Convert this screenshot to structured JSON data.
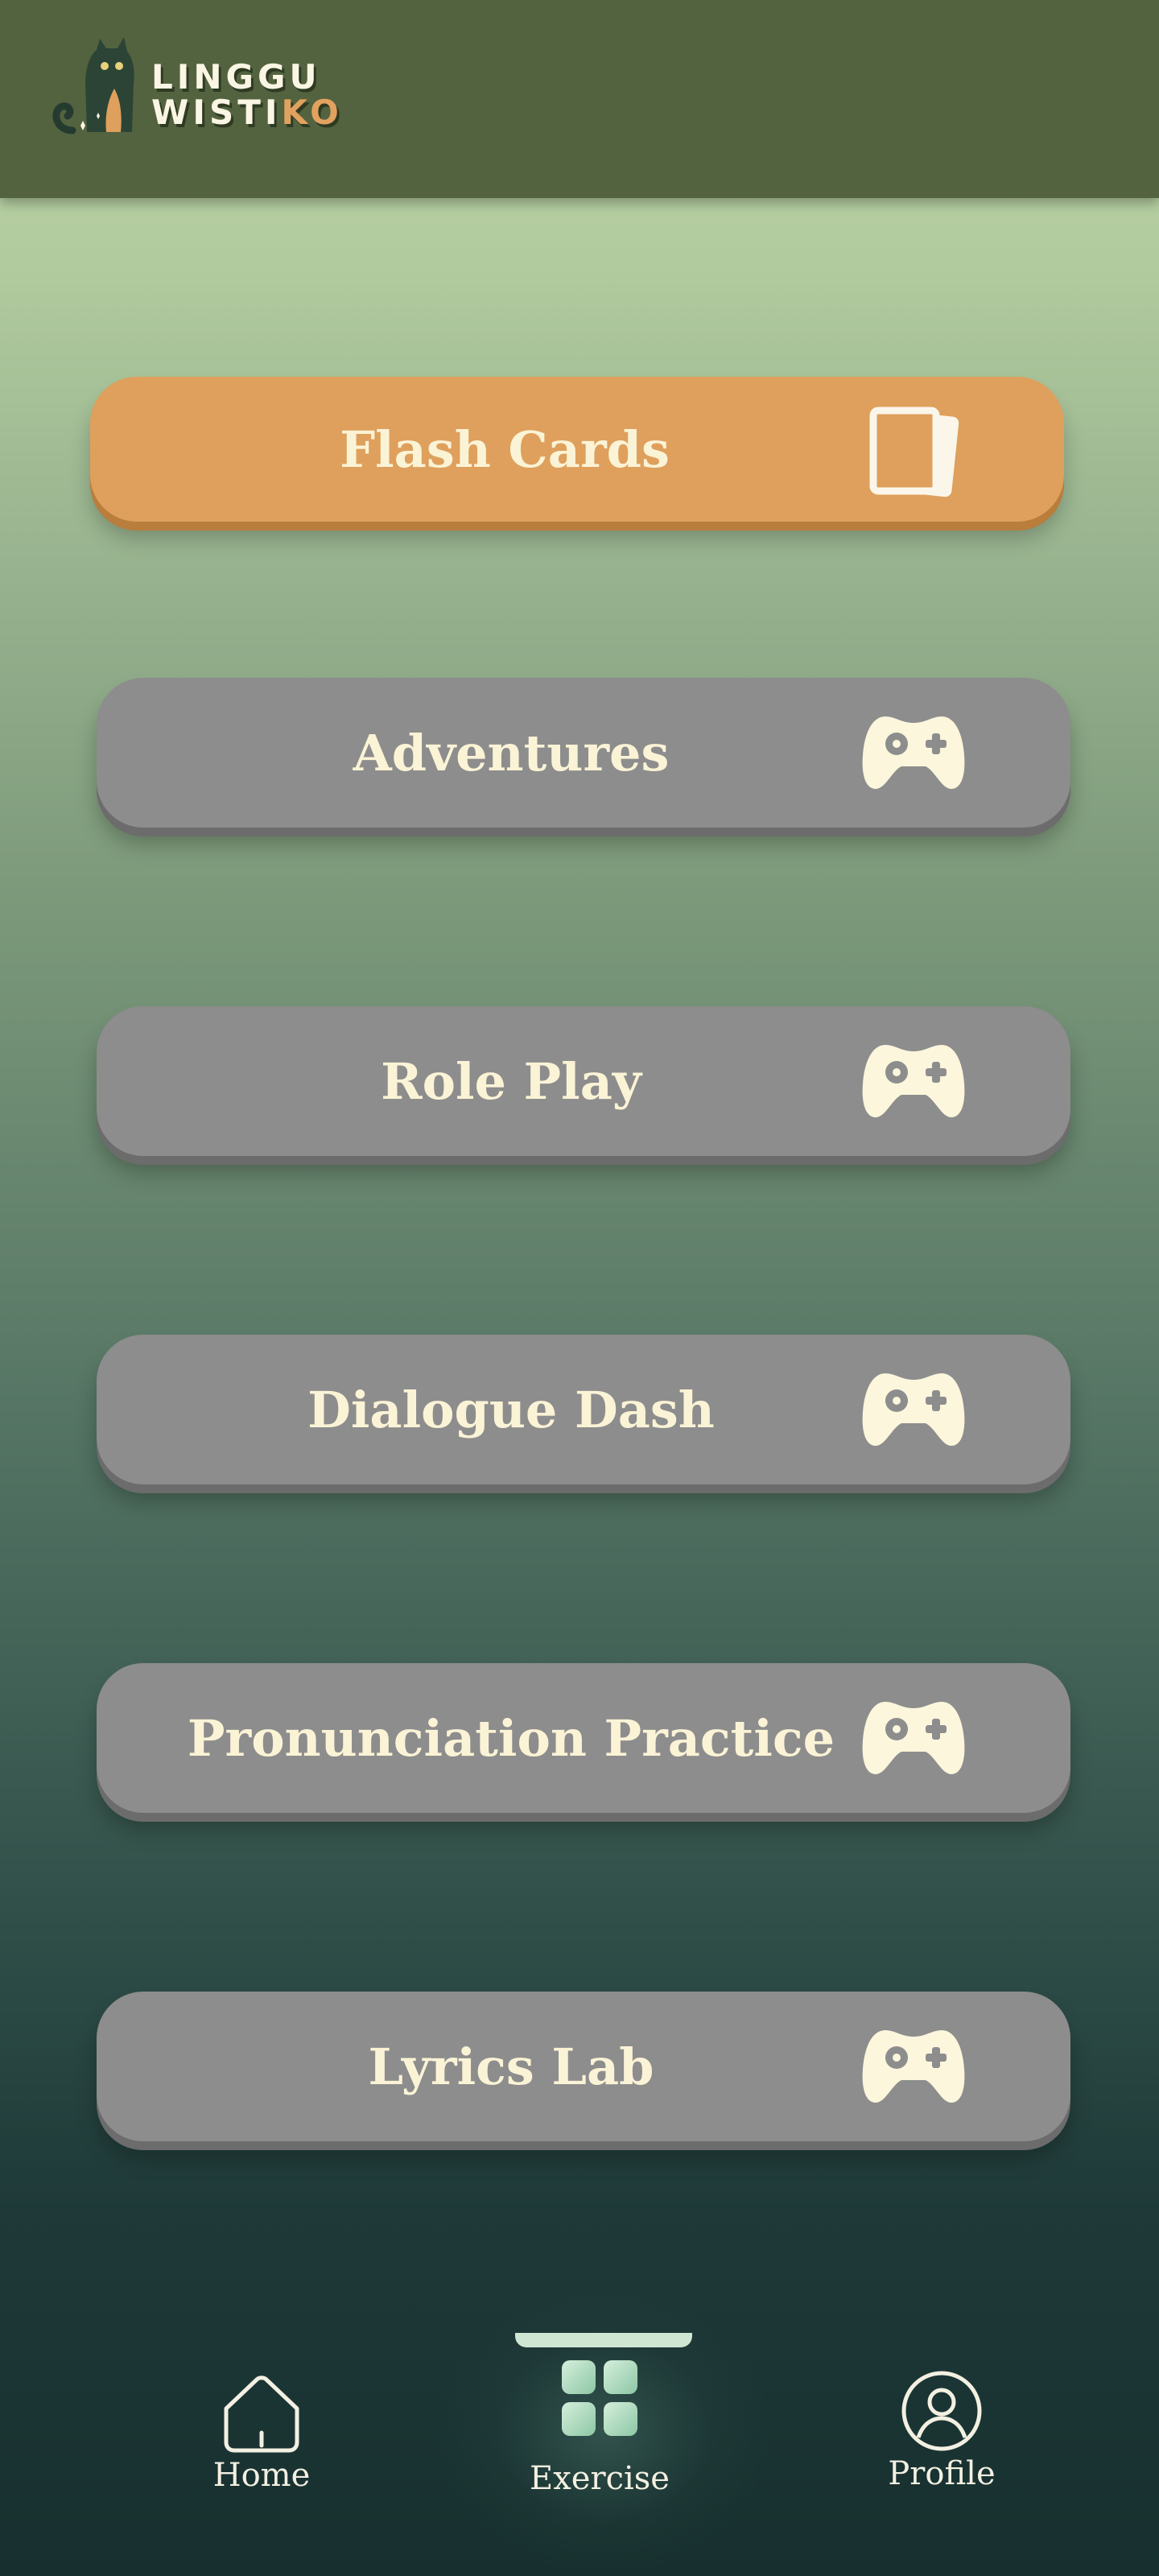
{
  "header": {
    "logo_line1": "LINGGU",
    "logo_line2_main": "WISTI",
    "logo_line2_accent": "KO"
  },
  "menu": {
    "items": [
      {
        "label": "Flash Cards",
        "icon": "cards-icon"
      },
      {
        "label": "Adventures",
        "icon": "gamepad-icon"
      },
      {
        "label": "Role Play",
        "icon": "gamepad-icon"
      },
      {
        "label": "Dialogue Dash",
        "icon": "gamepad-icon"
      },
      {
        "label": "Pronunciation Practice",
        "icon": "gamepad-icon"
      },
      {
        "label": "Lyrics Lab",
        "icon": "gamepad-icon"
      }
    ]
  },
  "nav": {
    "home_label": "Home",
    "exercise_label": "Exercise",
    "profile_label": "Profile",
    "active": "Exercise"
  },
  "colors": {
    "header_bg": "#53633f",
    "flash_button": "#dea05c",
    "game_button": "#8d8d8d",
    "label_text": "#fbf3d6",
    "nav_indicator": "#cfe6d2"
  }
}
